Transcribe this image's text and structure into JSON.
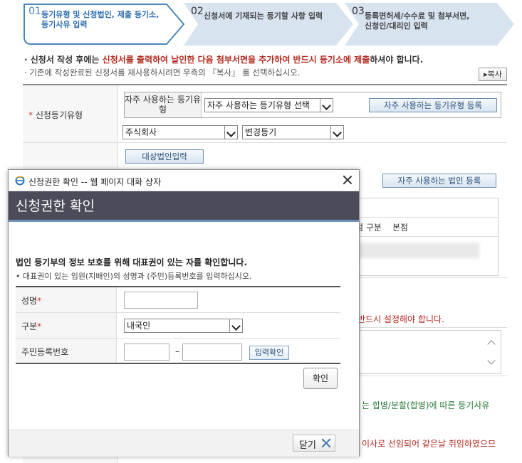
{
  "steps": [
    {
      "num": "01",
      "line1": "등기유형 및 신청법인, 제출 등기소,",
      "line2": "등기사유 입력"
    },
    {
      "num": "02",
      "line1": "신청서에 기재되는 등기할 사항 입력",
      "line2": ""
    },
    {
      "num": "03",
      "line1": "등록면허세/수수료 및 첨부서면,",
      "line2": "신청인/대리인 입력"
    }
  ],
  "notices": {
    "line1_pre": "· 신청서 작성 후에는 ",
    "line1_red": "신청서를 출력하여 날인한 다음 첨부서면을 추가하여 반드시 등기소에 제출",
    "line1_post": "하셔야 합니다.",
    "line2": "· 기존에 작성완료된 신청서를 재사용하시려면 우측의 『복사』 를 선택하십시오.",
    "copy_button": "복사"
  },
  "form": {
    "type_label": "신청등기유형",
    "freq_type_label": "자주 사용하는 등기유형",
    "freq_type_select": "자주 사용하는 등기유형 선택",
    "freq_type_register": "자주 사용하는 등기유형 등록",
    "company_type": "주식회사",
    "reg_type": "변경등기",
    "target_corp_button": "대상법인입력",
    "freq_corp_register": "자주 사용하는 법인 등록",
    "branch_header": "점 구분",
    "branch_value": "본점",
    "red_text_1": "반드시 설정해야 합니다.",
    "green_text": "는 합병/분할(합병)에 따른 등기사유",
    "red_text_2": "이사로 선임되어 같은날 취임하였으므"
  },
  "dialog": {
    "window_title": "신청권한 확인 -- 웹 페이지 대화 상자",
    "header": "신청권한 확인",
    "info_bold": "법인 등기부의 정보 보호를 위해 대표권이 있는 자를 확인합니다.",
    "info_sub": "• 대표권이 있는 임원(지배인)의 성명과 (주민)등록번호를 입력하십시오.",
    "name_label": "성명",
    "category_label": "구분",
    "category_value": "내국인",
    "rrn_label": "주민등록번호",
    "rrn_dash": "–",
    "confirm_input_button": "입력확인",
    "ok_button": "확인",
    "close_button": "닫기",
    "required_mark": "*"
  }
}
